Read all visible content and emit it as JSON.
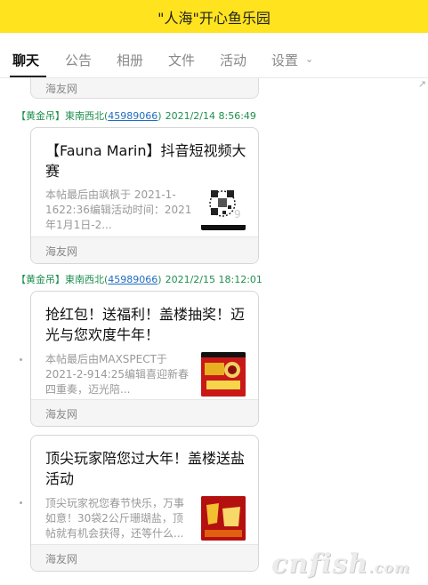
{
  "window": {
    "title": "\"人海\"开心鱼乐园"
  },
  "tabs": [
    {
      "label": "聊天",
      "active": true
    },
    {
      "label": "公告"
    },
    {
      "label": "相册"
    },
    {
      "label": "文件"
    },
    {
      "label": "活动"
    },
    {
      "label": "设置"
    }
  ],
  "previous_card": {
    "source": "海友网"
  },
  "messages": [
    {
      "sender": "【黄金吊】東南西北",
      "qq_number": "45989066",
      "time": "2021/2/14 8:56:49",
      "card": {
        "title": "【Fauna Marin】抖音短视频大赛",
        "description": "本帖最后由飒枫于 2021-1-1622:36编辑活动时间：2021年1月1日-2...",
        "source": "海友网",
        "thumb_icon": "qr-code-thumbnail"
      }
    },
    {
      "sender": "【黄金吊】東南西北",
      "qq_number": "45989066",
      "time": "2021/2/15 18:12:01",
      "card": {
        "title": "抢红包！送福利！盖楼抽奖！迈光与您欢度牛年！",
        "description": "本帖最后由MAXSPECT于 2021-2-914:25编辑喜迎新春四重奏，迈光陪...",
        "source": "海友网",
        "thumb_icon": "new-year-promo-thumbnail"
      }
    },
    {
      "card": {
        "title": "顶尖玩家陪您过大年！盖楼送盐活动",
        "description": "顶尖玩家祝您春节快乐，万事如意！30袋2公斤珊瑚盐，顶帖就有机会获得，还等什么...",
        "source": "海友网",
        "thumb_icon": "spring-festival-thumbnail"
      }
    }
  ],
  "watermark": {
    "main": "cnfish",
    "suffix": ".com"
  },
  "colors": {
    "title_bar": "#ffe31f",
    "sender_green": "#1e8f4e",
    "link_blue": "#1f6cc0"
  }
}
